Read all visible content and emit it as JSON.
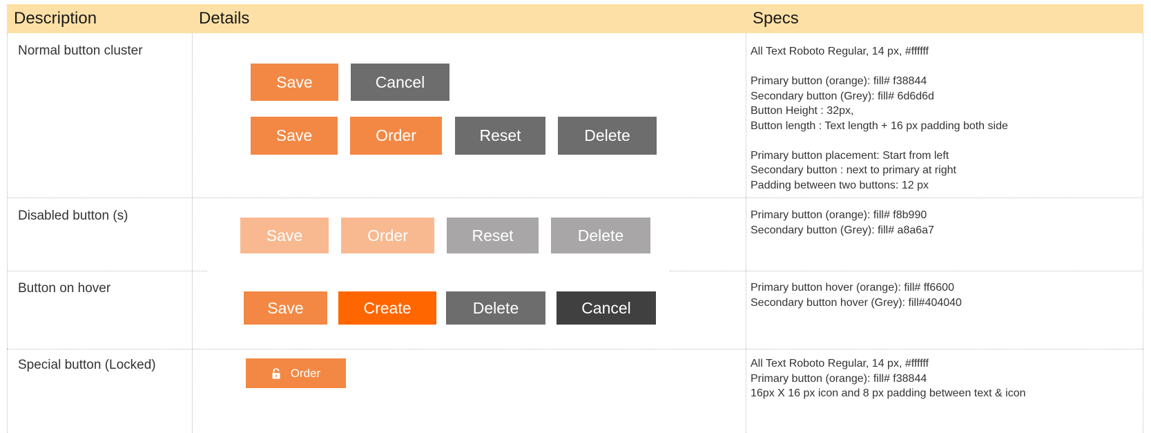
{
  "header": {
    "description": "Description",
    "details": "Details",
    "specs": "Specs"
  },
  "colors": {
    "header_bg": "#fde0a6",
    "primary": "#f38844",
    "secondary": "#6d6d6d",
    "primary_disabled": "#f8b990",
    "secondary_disabled": "#a8a6a7",
    "primary_hover": "#ff6600",
    "secondary_hover": "#404040"
  },
  "rows": [
    {
      "description": "Normal button cluster",
      "buttons_row1": [
        "Save",
        "Cancel"
      ],
      "buttons_row2": [
        "Save",
        "Order",
        "Reset",
        "Delete"
      ],
      "specs": "All Text Roboto Regular, 14 px, #ffffff\n\nPrimary button (orange): fill# f38844\nSecondary button (Grey): fill# 6d6d6d\nButton Height : 32px,\nButton length : Text length + 16 px padding both side\n\nPrimary button placement: Start from left\nSecondary button : next to primary at right\nPadding between two buttons: 12 px"
    },
    {
      "description": "Disabled button (s)",
      "buttons": [
        "Save",
        "Order",
        "Reset",
        "Delete"
      ],
      "specs": "Primary button (orange): fill# f8b990\nSecondary button (Grey): fill# a8a6a7"
    },
    {
      "description": "Button on hover",
      "buttons": [
        "Save",
        "Create",
        "Delete",
        "Cancel"
      ],
      "specs": "Primary button hover (orange): fill# ff6600\nSecondary button hover (Grey): fill#404040"
    },
    {
      "description": "Special button (Locked)",
      "button": {
        "label": "Order",
        "icon": "lock-icon"
      },
      "specs": "All Text Roboto Regular, 14 px, #ffffff\nPrimary button (orange): fill# f38844\n16px X 16 px icon and 8 px padding between text & icon"
    }
  ]
}
